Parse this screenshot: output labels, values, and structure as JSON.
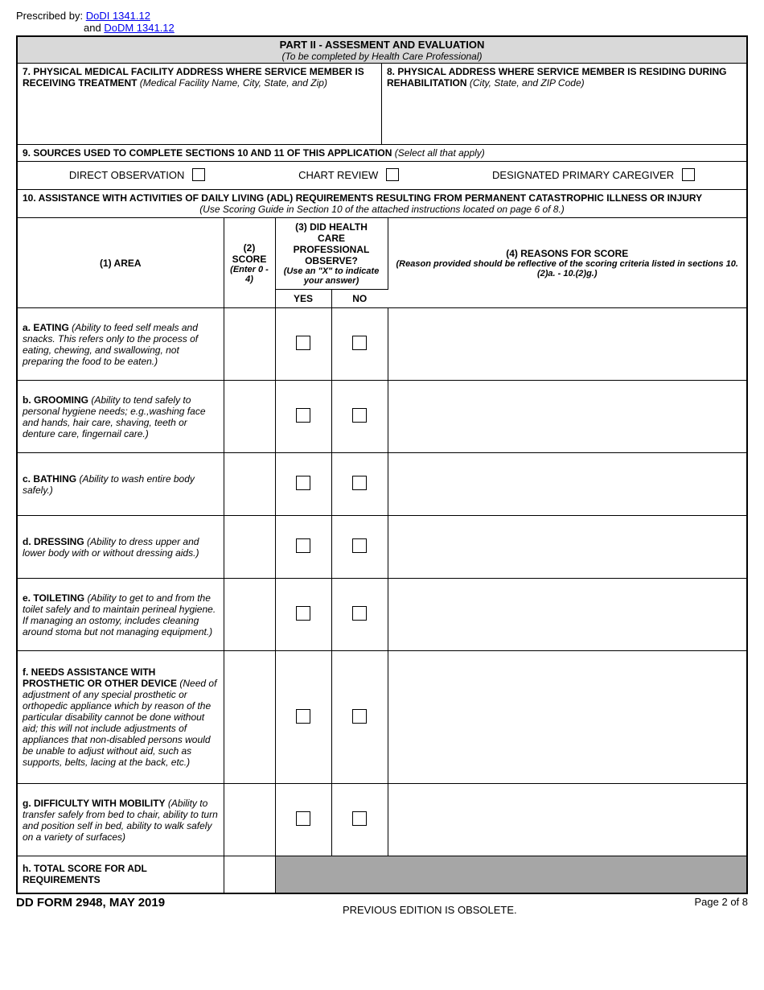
{
  "prescribed": {
    "label": "Prescribed by:",
    "link1": "DoDI 1341.12",
    "and": "and",
    "link2": "DoDM 1341.12"
  },
  "part2": {
    "title": "PART II - ASSESMENT AND EVALUATION",
    "sub": "(To be completed by Health Care Professional)"
  },
  "s7": {
    "label": "7. PHYSICAL MEDICAL FACILITY ADDRESS WHERE SERVICE MEMBER IS RECEIVING TREATMENT",
    "hint": "(Medical Facility Name, City, State, and Zip)"
  },
  "s8": {
    "label": "8. PHYSICAL ADDRESS WHERE SERVICE MEMBER IS RESIDING DURING REHABILITATION",
    "hint": "(City, State, and ZIP Code)"
  },
  "s9": {
    "label": "9. SOURCES USED TO COMPLETE SECTIONS 10 AND 11 OF THIS APPLICATION",
    "hint": "(Select all that apply)",
    "opt1": "DIRECT OBSERVATION",
    "opt2": "CHART REVIEW",
    "opt3": "DESIGNATED PRIMARY CAREGIVER"
  },
  "s10": {
    "label": "10. ASSISTANCE WITH ACTIVITIES OF DAILY LIVING (ADL) REQUIREMENTS RESULTING FROM PERMANENT CATASTROPHIC ILLNESS OR INJURY",
    "sub": "(Use Scoring Guide in Section 10 of the attached instructions located on page 6 of 8.)"
  },
  "hdr": {
    "area": "(1) AREA",
    "score": "(2) SCORE",
    "score_hint": "(Enter 0 - 4)",
    "observe": "(3) DID HEALTH CARE PROFESSIONAL OBSERVE?",
    "observe_hint": "(Use an \"X\" to indicate your answer)",
    "yes": "YES",
    "no": "NO",
    "reason": "(4) REASONS FOR SCORE",
    "reason_hint": "(Reason provided should be reflective of the scoring criteria listed in sections 10.(2)a. - 10.(2)g.)"
  },
  "rows": {
    "a": {
      "label": "a. EATING",
      "desc": "(Ability to feed self meals and snacks. This refers only to the process of eating, chewing, and swallowing, not preparing the food to be eaten.)"
    },
    "b": {
      "label": "b. GROOMING",
      "desc": "(Ability to tend safely to personal hygiene needs; e.g.,washing face and hands, hair care, shaving, teeth or denture care, fingernail care.)"
    },
    "c": {
      "label": "c. BATHING",
      "desc": "(Ability to wash entire body safely.)"
    },
    "d": {
      "label": "d. DRESSING",
      "desc": "(Ability to dress upper and lower body with or without dressing aids.)"
    },
    "e": {
      "label": "e. TOILETING",
      "desc": "(Ability to get to and from the toilet safely and to maintain perineal hygiene. If managing an ostomy, includes cleaning around stoma but not managing equipment.)"
    },
    "f": {
      "label": "f. NEEDS ASSISTANCE WITH PROSTHETIC OR OTHER DEVICE",
      "desc": "(Need of adjustment of any special prosthetic or orthopedic appliance which by reason of the particular disability cannot be done without aid; this will not include adjustments of appliances that non-disabled persons would be unable to adjust without aid, such as supports, belts, lacing at the back, etc.)"
    },
    "g": {
      "label": "g. DIFFICULTY WITH MOBILITY",
      "desc": "(Ability to transfer safely from bed to chair, ability to turn and position self in bed, ability to walk safely on a variety of surfaces)"
    },
    "h": {
      "label": "h. TOTAL SCORE FOR ADL REQUIREMENTS"
    }
  },
  "footer": {
    "left": "DD FORM 2948, MAY 2019",
    "center": "PREVIOUS EDITION IS OBSOLETE.",
    "right": "Page 2 of 8"
  }
}
